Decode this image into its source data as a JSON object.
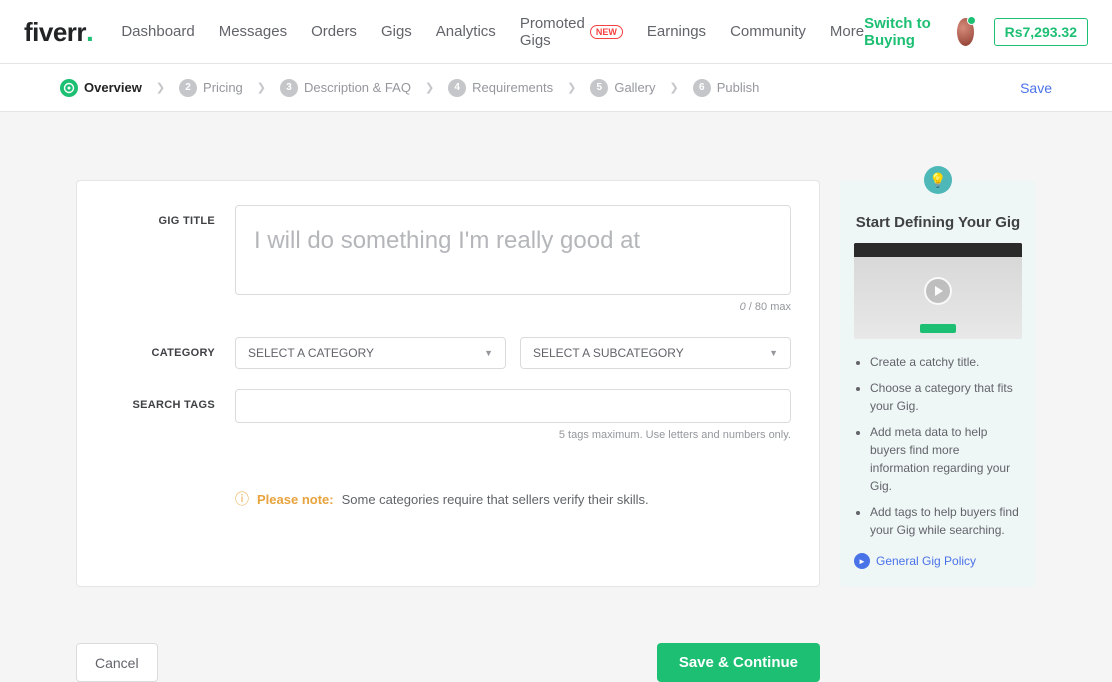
{
  "header": {
    "logo": "fiverr",
    "nav": [
      "Dashboard",
      "Messages",
      "Orders",
      "Gigs",
      "Analytics",
      "Promoted Gigs",
      "Earnings",
      "Community",
      "More"
    ],
    "new_badge": "NEW",
    "switch": "Switch to Buying",
    "balance": "Rs7,293.32"
  },
  "steps": {
    "items": [
      {
        "label": "Overview"
      },
      {
        "num": "2",
        "label": "Pricing"
      },
      {
        "num": "3",
        "label": "Description & FAQ"
      },
      {
        "num": "4",
        "label": "Requirements"
      },
      {
        "num": "5",
        "label": "Gallery"
      },
      {
        "num": "6",
        "label": "Publish"
      }
    ],
    "save": "Save"
  },
  "form": {
    "title_label": "GIG TITLE",
    "title_placeholder": "I will do something I'm really good at",
    "title_count": "0",
    "title_max": " / 80 max",
    "category_label": "CATEGORY",
    "category_placeholder": "SELECT A CATEGORY",
    "subcategory_placeholder": "SELECT A SUBCATEGORY",
    "tags_label": "SEARCH TAGS",
    "tags_hint": "5 tags maximum. Use letters and numbers only.",
    "note_label": "Please note:",
    "note_text": "Some categories require that sellers verify their skills."
  },
  "sidebar": {
    "title": "Start Defining Your Gig",
    "tips": [
      "Create a catchy title.",
      "Choose a category that fits your Gig.",
      "Add meta data to help buyers find more information regarding your Gig.",
      "Add tags to help buyers find your Gig while searching."
    ],
    "policy": "General Gig Policy"
  },
  "actions": {
    "cancel": "Cancel",
    "continue": "Save & Continue"
  }
}
